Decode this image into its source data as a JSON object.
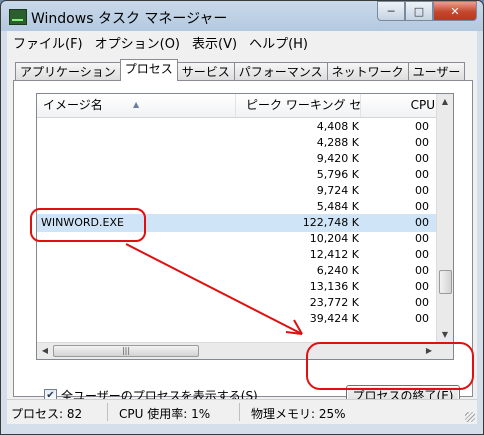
{
  "window": {
    "title": "Windows タスク マネージャー",
    "controls": {
      "minimize": "─",
      "maximize": "□",
      "close": "✕"
    }
  },
  "menu": [
    "ファイル(F)",
    "オプション(O)",
    "表示(V)",
    "ヘルプ(H)"
  ],
  "tabs": [
    {
      "label": "アプリケーション",
      "active": false
    },
    {
      "label": "プロセス",
      "active": true
    },
    {
      "label": "サービス",
      "active": false
    },
    {
      "label": "パフォーマンス",
      "active": false
    },
    {
      "label": "ネットワーク",
      "active": false
    },
    {
      "label": "ユーザー",
      "active": false
    }
  ],
  "process_list": {
    "columns": {
      "name": "イメージ名",
      "working_set": "ピーク ワーキング セッ...",
      "cpu": "CPU"
    },
    "rows": [
      {
        "name": "",
        "working_set": "4,408 K",
        "cpu": "00"
      },
      {
        "name": "",
        "working_set": "4,288 K",
        "cpu": "00"
      },
      {
        "name": "",
        "working_set": "9,420 K",
        "cpu": "00"
      },
      {
        "name": "",
        "working_set": "5,796 K",
        "cpu": "00"
      },
      {
        "name": "",
        "working_set": "9,724 K",
        "cpu": "00"
      },
      {
        "name": "",
        "working_set": "5,484 K",
        "cpu": "00"
      },
      {
        "name": "WINWORD.EXE",
        "working_set": "122,748 K",
        "cpu": "00"
      },
      {
        "name": "",
        "working_set": "10,204 K",
        "cpu": "00"
      },
      {
        "name": "",
        "working_set": "12,412 K",
        "cpu": "00"
      },
      {
        "name": "",
        "working_set": "6,240 K",
        "cpu": "00"
      },
      {
        "name": "",
        "working_set": "13,136 K",
        "cpu": "00"
      },
      {
        "name": "",
        "working_set": "23,772 K",
        "cpu": "00"
      },
      {
        "name": "",
        "working_set": "39,424 K",
        "cpu": "00"
      }
    ],
    "selected_index": 6
  },
  "show_all_users": {
    "label": "全ユーザーのプロセスを表示する(S)",
    "checked": true
  },
  "end_process_button": "プロセスの終了(E)",
  "status": {
    "processes": "プロセス: 82",
    "cpu": "CPU 使用率: 1%",
    "memory": "物理メモリ: 25%"
  },
  "colors": {
    "annotation": "#e01010",
    "selection": "#cfe4f6"
  }
}
